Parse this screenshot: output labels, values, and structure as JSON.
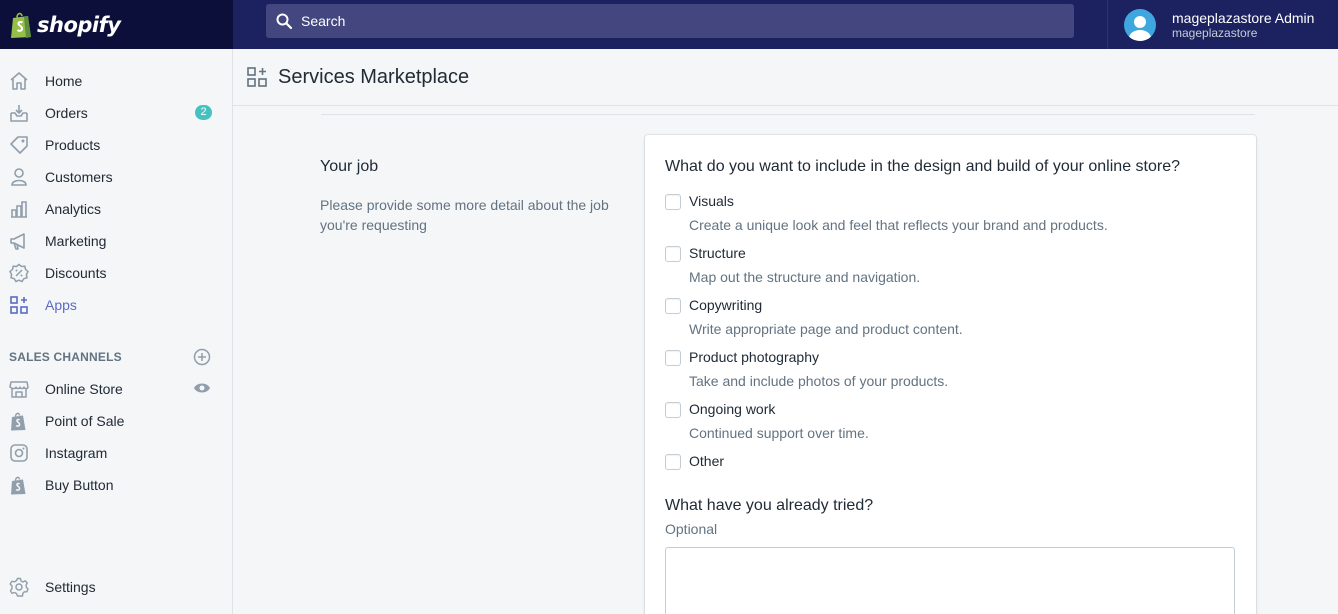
{
  "brand": {
    "name": "shopify"
  },
  "search": {
    "placeholder": "Search"
  },
  "user": {
    "name": "mageplazastore Admin",
    "store": "mageplazastore"
  },
  "sidebar": {
    "items": [
      {
        "label": "Home",
        "icon": "home-icon"
      },
      {
        "label": "Orders",
        "icon": "orders-icon",
        "badge": "2"
      },
      {
        "label": "Products",
        "icon": "tag-icon"
      },
      {
        "label": "Customers",
        "icon": "person-icon"
      },
      {
        "label": "Analytics",
        "icon": "bar-chart-icon"
      },
      {
        "label": "Marketing",
        "icon": "megaphone-icon"
      },
      {
        "label": "Discounts",
        "icon": "discount-icon"
      },
      {
        "label": "Apps",
        "icon": "apps-icon",
        "active": true
      }
    ],
    "sales_channels_title": "SALES CHANNELS",
    "channels": [
      {
        "label": "Online Store",
        "icon": "store-icon"
      },
      {
        "label": "Point of Sale",
        "icon": "shopify-bag-icon"
      },
      {
        "label": "Instagram",
        "icon": "instagram-icon"
      },
      {
        "label": "Buy Button",
        "icon": "shopify-bag-icon"
      }
    ],
    "settings_label": "Settings"
  },
  "page": {
    "title": "Services Marketplace"
  },
  "job": {
    "title": "Your job",
    "description": "Please provide some more detail about the job you're requesting"
  },
  "form": {
    "question": "What do you want to include in the design and build of your online store?",
    "options": [
      {
        "label": "Visuals",
        "help": "Create a unique look and feel that reflects your brand and products.",
        "checked": false
      },
      {
        "label": "Structure",
        "help": "Map out the structure and navigation.",
        "checked": false
      },
      {
        "label": "Copywriting",
        "help": "Write appropriate page and product content.",
        "checked": false
      },
      {
        "label": "Product photography",
        "help": "Take and include photos of your products.",
        "checked": false
      },
      {
        "label": "Ongoing work",
        "help": "Continued support over time.",
        "checked": false
      },
      {
        "label": "Other",
        "help": "",
        "checked": false
      }
    ],
    "question2": "What have you already tried?",
    "optional_label": "Optional",
    "textarea_value": ""
  },
  "colors": {
    "topbar": "#1c2260",
    "accent": "#5c6ac4",
    "badge": "#47c1bf"
  }
}
